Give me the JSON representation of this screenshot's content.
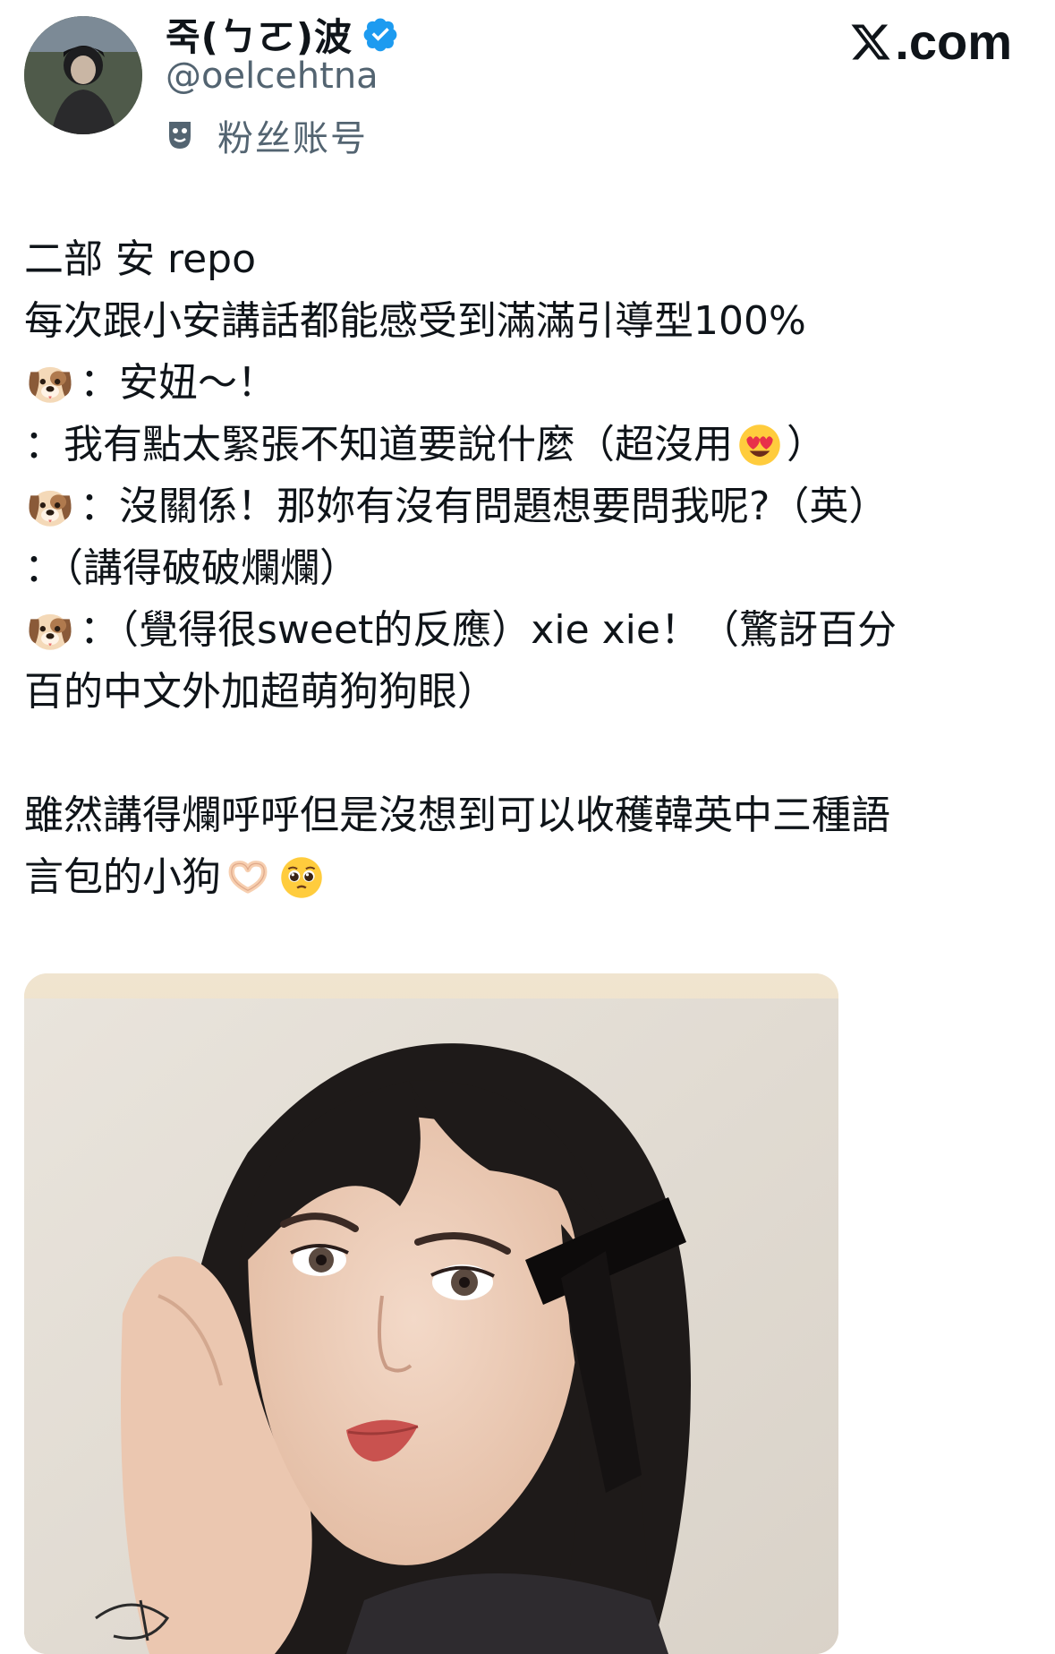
{
  "header": {
    "display_name": "죽(ㄅㄛ)波",
    "handle": "@oelcehtna",
    "fan_label": "粉丝账号",
    "site": ".com"
  },
  "post": {
    "lines": [
      {
        "segments": [
          "二部 安 repo"
        ]
      },
      {
        "segments": [
          "每次跟小安講話都能感受到滿滿引導型100%"
        ]
      },
      {
        "dog": true,
        "segments": [
          "：安妞～！"
        ]
      },
      {
        "segments": [
          "：我有點太緊張不知道要說什麼（超沒用",
          "）"
        ],
        "inline_emoji_after": 0,
        "inline_emoji": "heart-eyes-emoji"
      },
      {
        "dog": true,
        "segments": [
          "：沒關係！那妳有沒有問題想要問我呢?（英）"
        ]
      },
      {
        "segments": [
          "：（講得破破爛爛）"
        ]
      },
      {
        "dog": true,
        "segments": [
          "：（覺得很sweet的反應）xie xie！（驚訝百分"
        ]
      },
      {
        "segments": [
          "百的中文外加超萌狗狗眼）"
        ]
      },
      {
        "blank": true,
        "segments": [
          ""
        ]
      },
      {
        "segments": [
          "雖然講得爛呼呼但是沒想到可以收穫韓英中三種語"
        ]
      },
      {
        "segments": [
          "言包的小狗"
        ],
        "trailing_emojis": [
          "heart-hands-emoji",
          "pleading-face-emoji"
        ]
      }
    ]
  },
  "media": {
    "type": "photo"
  }
}
